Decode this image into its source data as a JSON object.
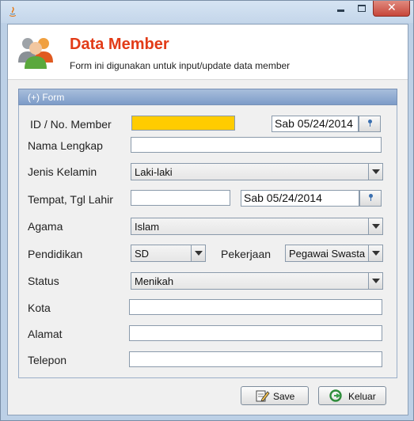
{
  "window": {
    "title": "",
    "icon": "java-icon",
    "controls": [
      "minimize-icon",
      "maximize-icon",
      "close-icon"
    ]
  },
  "header": {
    "title": "Data Member",
    "subtitle": "Form ini digunakan untuk input/update data member",
    "icon": "users-icon"
  },
  "section": {
    "label": "(+) Form"
  },
  "form": {
    "id_label": "ID / No. Member",
    "id_value": "",
    "date_value": "Sab 05/24/2014",
    "nama_label": "Nama Lengkap",
    "nama_value": "",
    "jk_label": "Jenis Kelamin",
    "jk_value": "Laki-laki",
    "ttl_label": "Tempat, Tgl Lahir",
    "tempat_value": "",
    "tgl_lahir_value": "Sab 05/24/2014",
    "agama_label": "Agama",
    "agama_value": "Islam",
    "pendidikan_label": "Pendidikan",
    "pendidikan_value": "SD",
    "pekerjaan_label": "Pekerjaan",
    "pekerjaan_value": "Pegawai Swasta",
    "status_label": "Status",
    "status_value": "Menikah",
    "kota_label": "Kota",
    "kota_value": "",
    "alamat_label": "Alamat",
    "alamat_value": "",
    "telepon_label": "Telepon",
    "telepon_value": ""
  },
  "buttons": {
    "save_label": "Save",
    "keluar_label": "Keluar"
  },
  "colors": {
    "title": "#e23b17",
    "id_field_highlight": "#ffcc00",
    "section_bar": "#7d9cc8"
  }
}
